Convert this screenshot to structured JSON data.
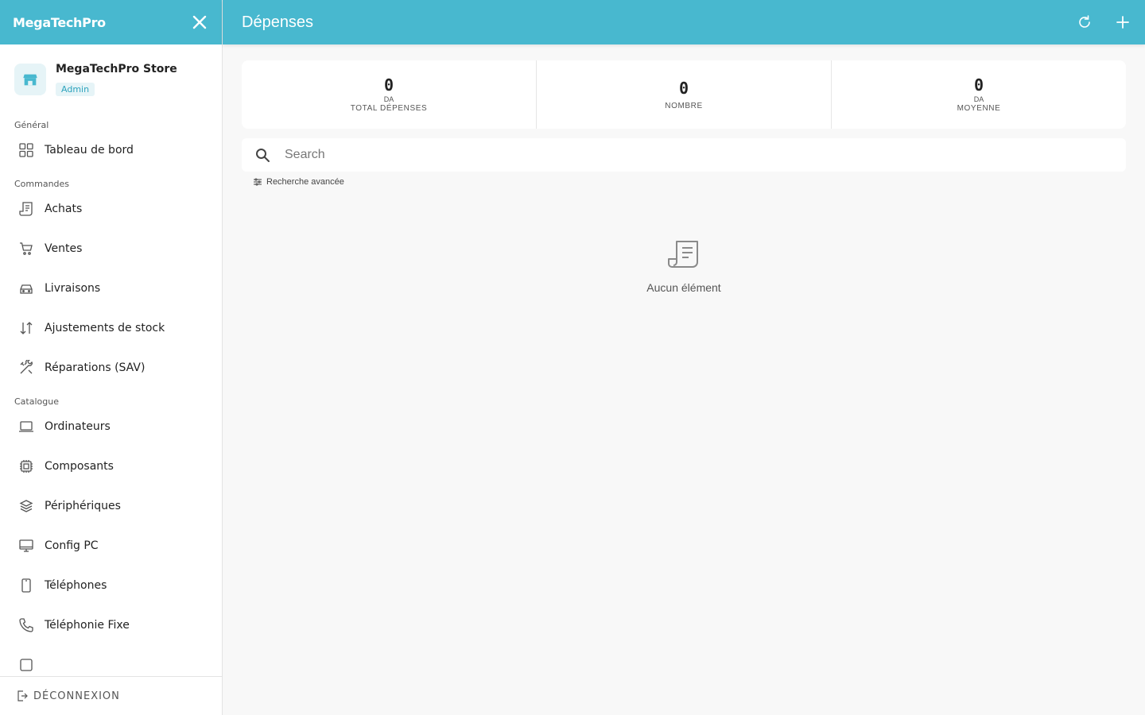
{
  "sidebar": {
    "brand": "MegaTechPro",
    "store_name": "MegaTechPro Store",
    "role_badge": "Admin",
    "sections": [
      {
        "title": "Général",
        "items": [
          {
            "label": "Tableau de bord",
            "icon": "grid-icon"
          }
        ]
      },
      {
        "title": "Commandes",
        "items": [
          {
            "label": "Achats",
            "icon": "receipt-icon"
          },
          {
            "label": "Ventes",
            "icon": "cart-icon"
          },
          {
            "label": "Livraisons",
            "icon": "car-icon"
          },
          {
            "label": "Ajustements de stock",
            "icon": "arrows-updown-icon"
          },
          {
            "label": "Réparations (SAV)",
            "icon": "tools-icon"
          }
        ]
      },
      {
        "title": "Catalogue",
        "items": [
          {
            "label": "Ordinateurs",
            "icon": "laptop-icon"
          },
          {
            "label": "Composants",
            "icon": "chip-icon"
          },
          {
            "label": "Périphériques",
            "icon": "layers-icon"
          },
          {
            "label": "Config PC",
            "icon": "monitor-icon"
          },
          {
            "label": "Téléphones",
            "icon": "phone-icon"
          },
          {
            "label": "Téléphonie Fixe",
            "icon": "landline-icon"
          }
        ]
      }
    ],
    "logout_label": "DÉCONNEXION"
  },
  "header": {
    "title": "Dépenses"
  },
  "stats": [
    {
      "value": "0",
      "unit": "DA",
      "label": "TOTAL DÉPENSES"
    },
    {
      "value": "0",
      "unit": "",
      "label": "NOMBRE"
    },
    {
      "value": "0",
      "unit": "DA",
      "label": "MOYENNE"
    }
  ],
  "search": {
    "placeholder": "Search",
    "advanced_label": "Recherche avancée"
  },
  "empty_state": {
    "text": "Aucun élément"
  },
  "colors": {
    "accent": "#48b8cf",
    "background": "#f8f8f8"
  }
}
